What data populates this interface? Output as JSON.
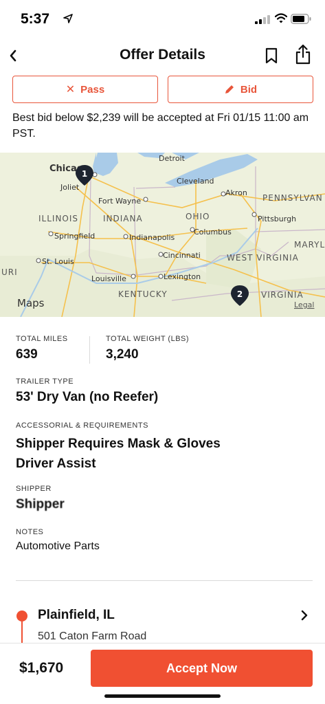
{
  "status_bar": {
    "time": "5:37"
  },
  "nav": {
    "title": "Offer Details"
  },
  "actions": {
    "pass_label": "Pass",
    "bid_label": "Bid"
  },
  "bid_note": "Best bid below $2,239 will be accepted at Fri 01/15 11:00 am PST.",
  "map": {
    "cities": [
      "Chicago",
      "Joliet",
      "Fort Wayne",
      "Detroit",
      "Cleveland",
      "Akron",
      "Pittsburgh",
      "Columbus",
      "Springfield",
      "Indianapolis",
      "Cincinnati",
      "St. Louis",
      "Louisville",
      "Lexington"
    ],
    "states": [
      "ILLINOIS",
      "INDIANA",
      "OHIO",
      "PENNSYLVAN",
      "MARYL",
      "WEST VIRGINIA",
      "KENTUCKY",
      "VIRGINIA",
      "URI"
    ],
    "markers": [
      "1",
      "2"
    ],
    "attribution": "Maps",
    "legal": "Legal"
  },
  "details": {
    "total_miles_label": "TOTAL MILES",
    "total_miles": "639",
    "total_weight_label": "TOTAL WEIGHT (LBS)",
    "total_weight": "3,240",
    "trailer_type_label": "TRAILER TYPE",
    "trailer_type": "53' Dry Van (no Reefer)",
    "accessorial_label": "ACCESSORIAL & REQUIREMENTS",
    "accessorial": [
      "Shipper Requires Mask & Gloves",
      "Driver Assist"
    ],
    "shipper_label": "SHIPPER",
    "shipper": "Shipper",
    "notes_label": "NOTES",
    "notes": "Automotive Parts"
  },
  "stop": {
    "city": "Plainfield, IL",
    "address": "501 Caton Farm Road"
  },
  "footer": {
    "price": "$1,670",
    "accept_label": "Accept Now"
  },
  "colors": {
    "accent": "#f05032",
    "outline": "#e8553a"
  }
}
